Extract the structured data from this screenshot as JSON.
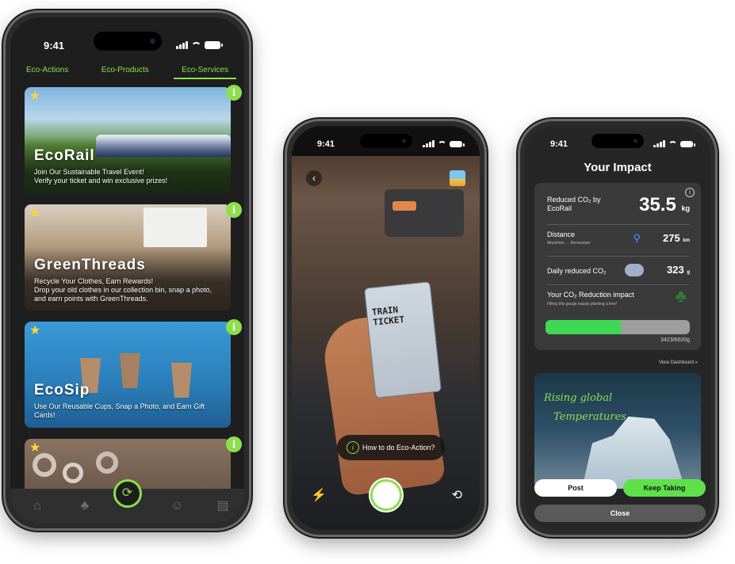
{
  "phone1": {
    "time": "9:41",
    "tabs": [
      {
        "label": "Eco-Actions",
        "active": false
      },
      {
        "label": "Eco-Products",
        "active": false
      },
      {
        "label": "Eco-Services",
        "active": true
      }
    ],
    "cards": [
      {
        "title": "EcoRail",
        "desc": "Join Our Sustainable Travel Event!\nVerify your ticket and win exclusive prizes!"
      },
      {
        "title": "GreenThreads",
        "desc": "Recycle Your Clothes, Earn Rewards!\nDrop your old clothes in our collection bin, snap a photo, and earn points with GreenThreads."
      },
      {
        "title": "EcoSip",
        "desc": "Use Our Reusable Cups, Snap a Photo, and Earn Gift Cards!"
      },
      {
        "title": "",
        "desc": ""
      }
    ],
    "nav": [
      "home-icon",
      "tree-icon",
      "recycle-icon",
      "community-icon",
      "store-icon"
    ]
  },
  "phone2": {
    "time": "9:41",
    "ticket_text": "TRAIN TICKET",
    "howto_label": "How to do Eco-Action?"
  },
  "phone3": {
    "time": "9:41",
    "title": "Your Impact",
    "reduced_label": "Reduced CO₂ by EcoRail",
    "reduced_value": "35.5",
    "reduced_unit": "kg",
    "distance_label": "Distance",
    "distance_route": "Moynihan → Rensselaer",
    "distance_value": "275",
    "distance_unit": "km",
    "daily_label": "Daily reduced CO₂",
    "daily_value": "323",
    "daily_unit": "g",
    "gauge_label": "Your CO₂ Reduction impact",
    "gauge_sub": "Filling this gauge equals planting a tree!",
    "gauge_fraction": 0.52,
    "gauge_value": "3423/6600g",
    "view_dashboard": "View Dashboard  »",
    "image_text_line1": "Rising global",
    "image_text_line2": "Temperatures",
    "post_label": "Post",
    "keep_label": "Keep Taking",
    "close_label": "Close"
  },
  "colors": {
    "accent": "#8be04b",
    "gauge": "#3fd852"
  }
}
